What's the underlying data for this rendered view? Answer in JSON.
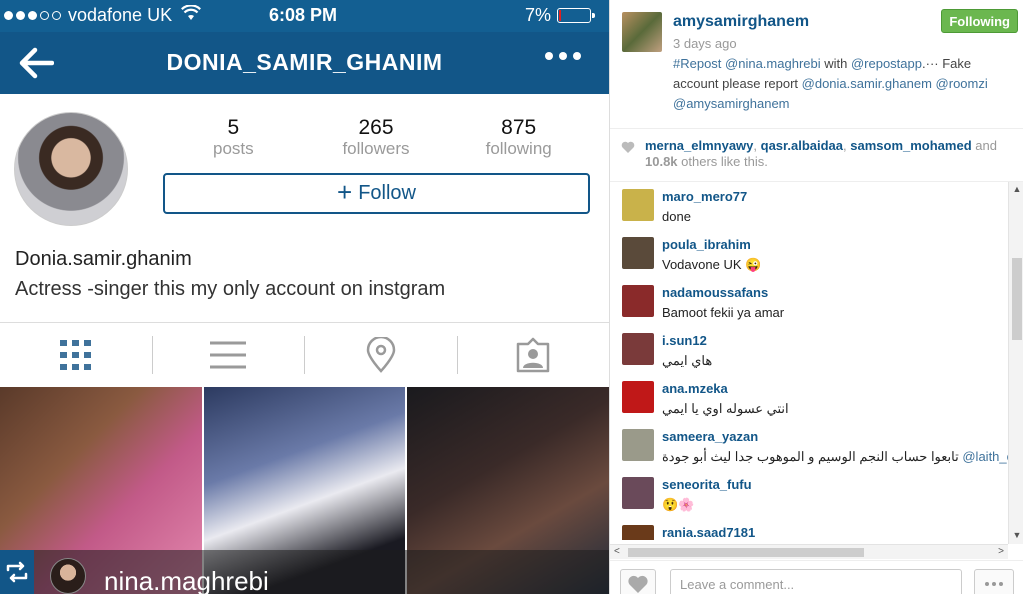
{
  "status_bar": {
    "carrier": "vodafone UK",
    "time": "6:08 PM",
    "battery_text": "7%",
    "battery_level": 0.07,
    "battery_color": "#e02020"
  },
  "nav": {
    "title": "DONIA_SAMIR_GHANIM"
  },
  "profile": {
    "stats": [
      {
        "value": "5",
        "label": "posts"
      },
      {
        "value": "265",
        "label": "followers"
      },
      {
        "value": "875",
        "label": "following"
      }
    ],
    "follow_label": "Follow",
    "follow_icon": "+",
    "name": "Donia.samir.ghanim",
    "bio": "Actress -singer this my only account on instgram"
  },
  "repost_bar": {
    "username": "nina.maghrebi"
  },
  "post": {
    "owner": "amysamirghanem",
    "age": "3 days ago",
    "following_label": "Following",
    "caption_parts": [
      {
        "text": "#Repost @nina.maghrebi",
        "link": true
      },
      {
        "text": " with ",
        "link": false
      },
      {
        "text": "@repostapp",
        "link": true
      },
      {
        "text": ".··· Fake account please report ",
        "link": false
      },
      {
        "text": "@donia.samir.ghanem",
        "link": true
      },
      {
        "text": " ",
        "link": false
      },
      {
        "text": "@roomzi",
        "link": true
      },
      {
        "text": " ",
        "link": false
      },
      {
        "text": "@amysamirghanem",
        "link": true
      }
    ]
  },
  "likes": {
    "user1": "merna_elmnyawy",
    "sep1": ", ",
    "user2": "qasr.albaidaa",
    "sep2": ", ",
    "user3": "samsom_mohamed",
    "and_text": " and",
    "count": "10.8k",
    "rest": " others like this."
  },
  "comments": [
    {
      "user": "maro_mero77",
      "text": "done",
      "avatar_color": "#c9b24a"
    },
    {
      "user": "poula_ibrahim",
      "text": "Vodavone UK 😜",
      "avatar_color": "#5a4a3a"
    },
    {
      "user": "nadamoussafans",
      "text": "Bamoot fekii ya amar",
      "avatar_color": "#8a2a2a"
    },
    {
      "user": "i.sun12",
      "text": "هاي ايمي",
      "avatar_color": "#7a3a3a"
    },
    {
      "user": "ana.mzeka",
      "text": "انتي عسوله اوي يا ايمي",
      "avatar_color": "#c01818"
    },
    {
      "user": "sameera_yazan",
      "text": "تابعوا حساب النجم الوسيم و الموهوب جدا ليث أبو جودة",
      "mention": " @laith_official",
      "avatar_color": "#9a9a8a"
    },
    {
      "user": "seneorita_fufu",
      "text": "😲🌸",
      "avatar_color": "#6a4a5a"
    },
    {
      "user": "rania.saad7181",
      "text": "",
      "avatar_color": "#6a3a1a"
    }
  ],
  "comment_bar": {
    "placeholder": "Leave a comment..."
  }
}
